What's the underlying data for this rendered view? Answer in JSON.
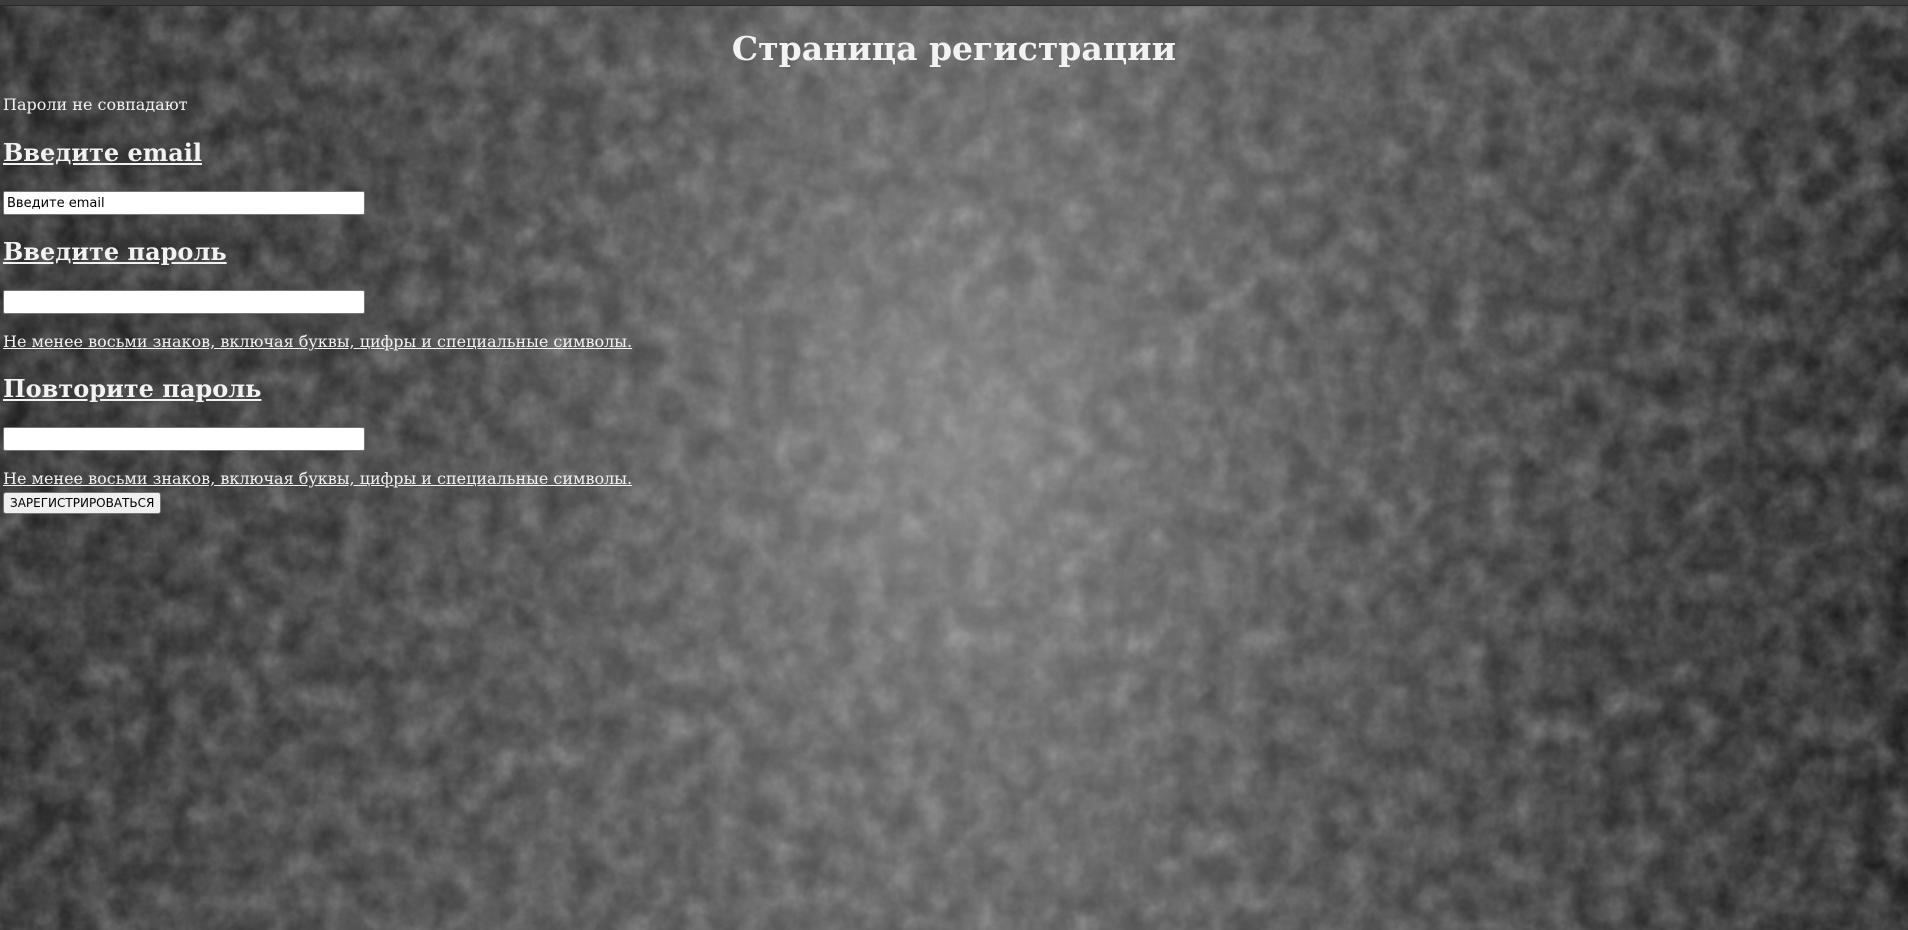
{
  "page": {
    "title": "Страница регистрации",
    "error_message": "Пароли не совпадают"
  },
  "form": {
    "email": {
      "heading": "Введите email",
      "placeholder": "Введите email",
      "value": ""
    },
    "password": {
      "heading": "Введите пароль",
      "value": "",
      "hint": "Не менее восьми знаков, включая буквы, цифры и специальные символы."
    },
    "password_repeat": {
      "heading": "Повторите пароль",
      "value": "",
      "hint": "Не менее восьми знаков, включая буквы, цифры и специальные символы."
    },
    "submit_label": "ЗАРЕГИСТРИРОВАТЬСЯ"
  },
  "colors": {
    "text": "#f2f2f2",
    "background_dark": "#1a1a1a",
    "background_light": "#6a6a6a"
  }
}
